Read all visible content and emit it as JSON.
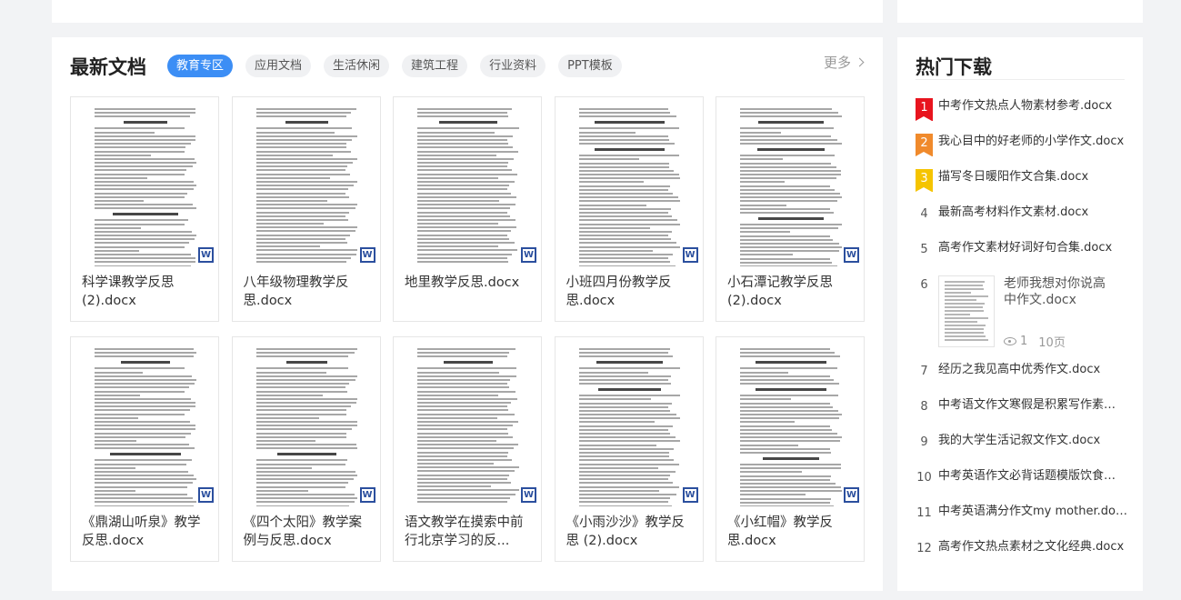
{
  "latest": {
    "title": "最新文档",
    "tabs": [
      {
        "label": "教育专区",
        "active": true
      },
      {
        "label": "应用文档",
        "active": false
      },
      {
        "label": "生活休闲",
        "active": false
      },
      {
        "label": "建筑工程",
        "active": false
      },
      {
        "label": "行业资料",
        "active": false
      },
      {
        "label": "PPT模板",
        "active": false
      }
    ],
    "more_label": "更多",
    "file_icon": "word-icon",
    "file_icon_letter": "W",
    "docs": [
      {
        "title": "科学课教学反思(2).docx"
      },
      {
        "title": "八年级物理教学反思.docx"
      },
      {
        "title": "地里教学反思.docx"
      },
      {
        "title": "小班四月份教学反思.docx"
      },
      {
        "title": "小石潭记教学反思(2).docx"
      },
      {
        "title": "《鼎湖山听泉》教学反思.docx"
      },
      {
        "title": "《四个太阳》教学案例与反思.docx"
      },
      {
        "title": "语文教学在摸索中前行北京学习的反..."
      },
      {
        "title": "《小雨沙沙》教学反思 (2).docx"
      },
      {
        "title": "《小红帽》教学反思.docx"
      }
    ]
  },
  "hot": {
    "title": "热门下载",
    "flag_colors": [
      "#e8141e",
      "#f08a2c",
      "#f5c400"
    ],
    "items": [
      {
        "rank": "1",
        "name": "中考作文热点人物素材参考.docx"
      },
      {
        "rank": "2",
        "name": "我心目中的好老师的小学作文.docx"
      },
      {
        "rank": "3",
        "name": "描写冬日暖阳作文合集.docx"
      },
      {
        "rank": "4",
        "name": "最新高考材料作文素材.docx"
      },
      {
        "rank": "5",
        "name": "高考作文素材好词好句合集.docx"
      },
      {
        "rank": "7",
        "name": "经历之我见高中优秀作文.docx"
      },
      {
        "rank": "8",
        "name": "中考语文作文寒假是积累写作素材的..."
      },
      {
        "rank": "9",
        "name": "我的大学生活记叙文作文.docx"
      },
      {
        "rank": "10",
        "name": "中考英语作文必背话题模版饮食安全..."
      },
      {
        "rank": "11",
        "name": "中考英语满分作文my mother.docx"
      },
      {
        "rank": "12",
        "name": "高考作文热点素材之文化经典.docx"
      }
    ],
    "featured": {
      "rank": "6",
      "name": "老师我想对你说高中作文.docx",
      "views": "1",
      "pages": "10页"
    }
  }
}
